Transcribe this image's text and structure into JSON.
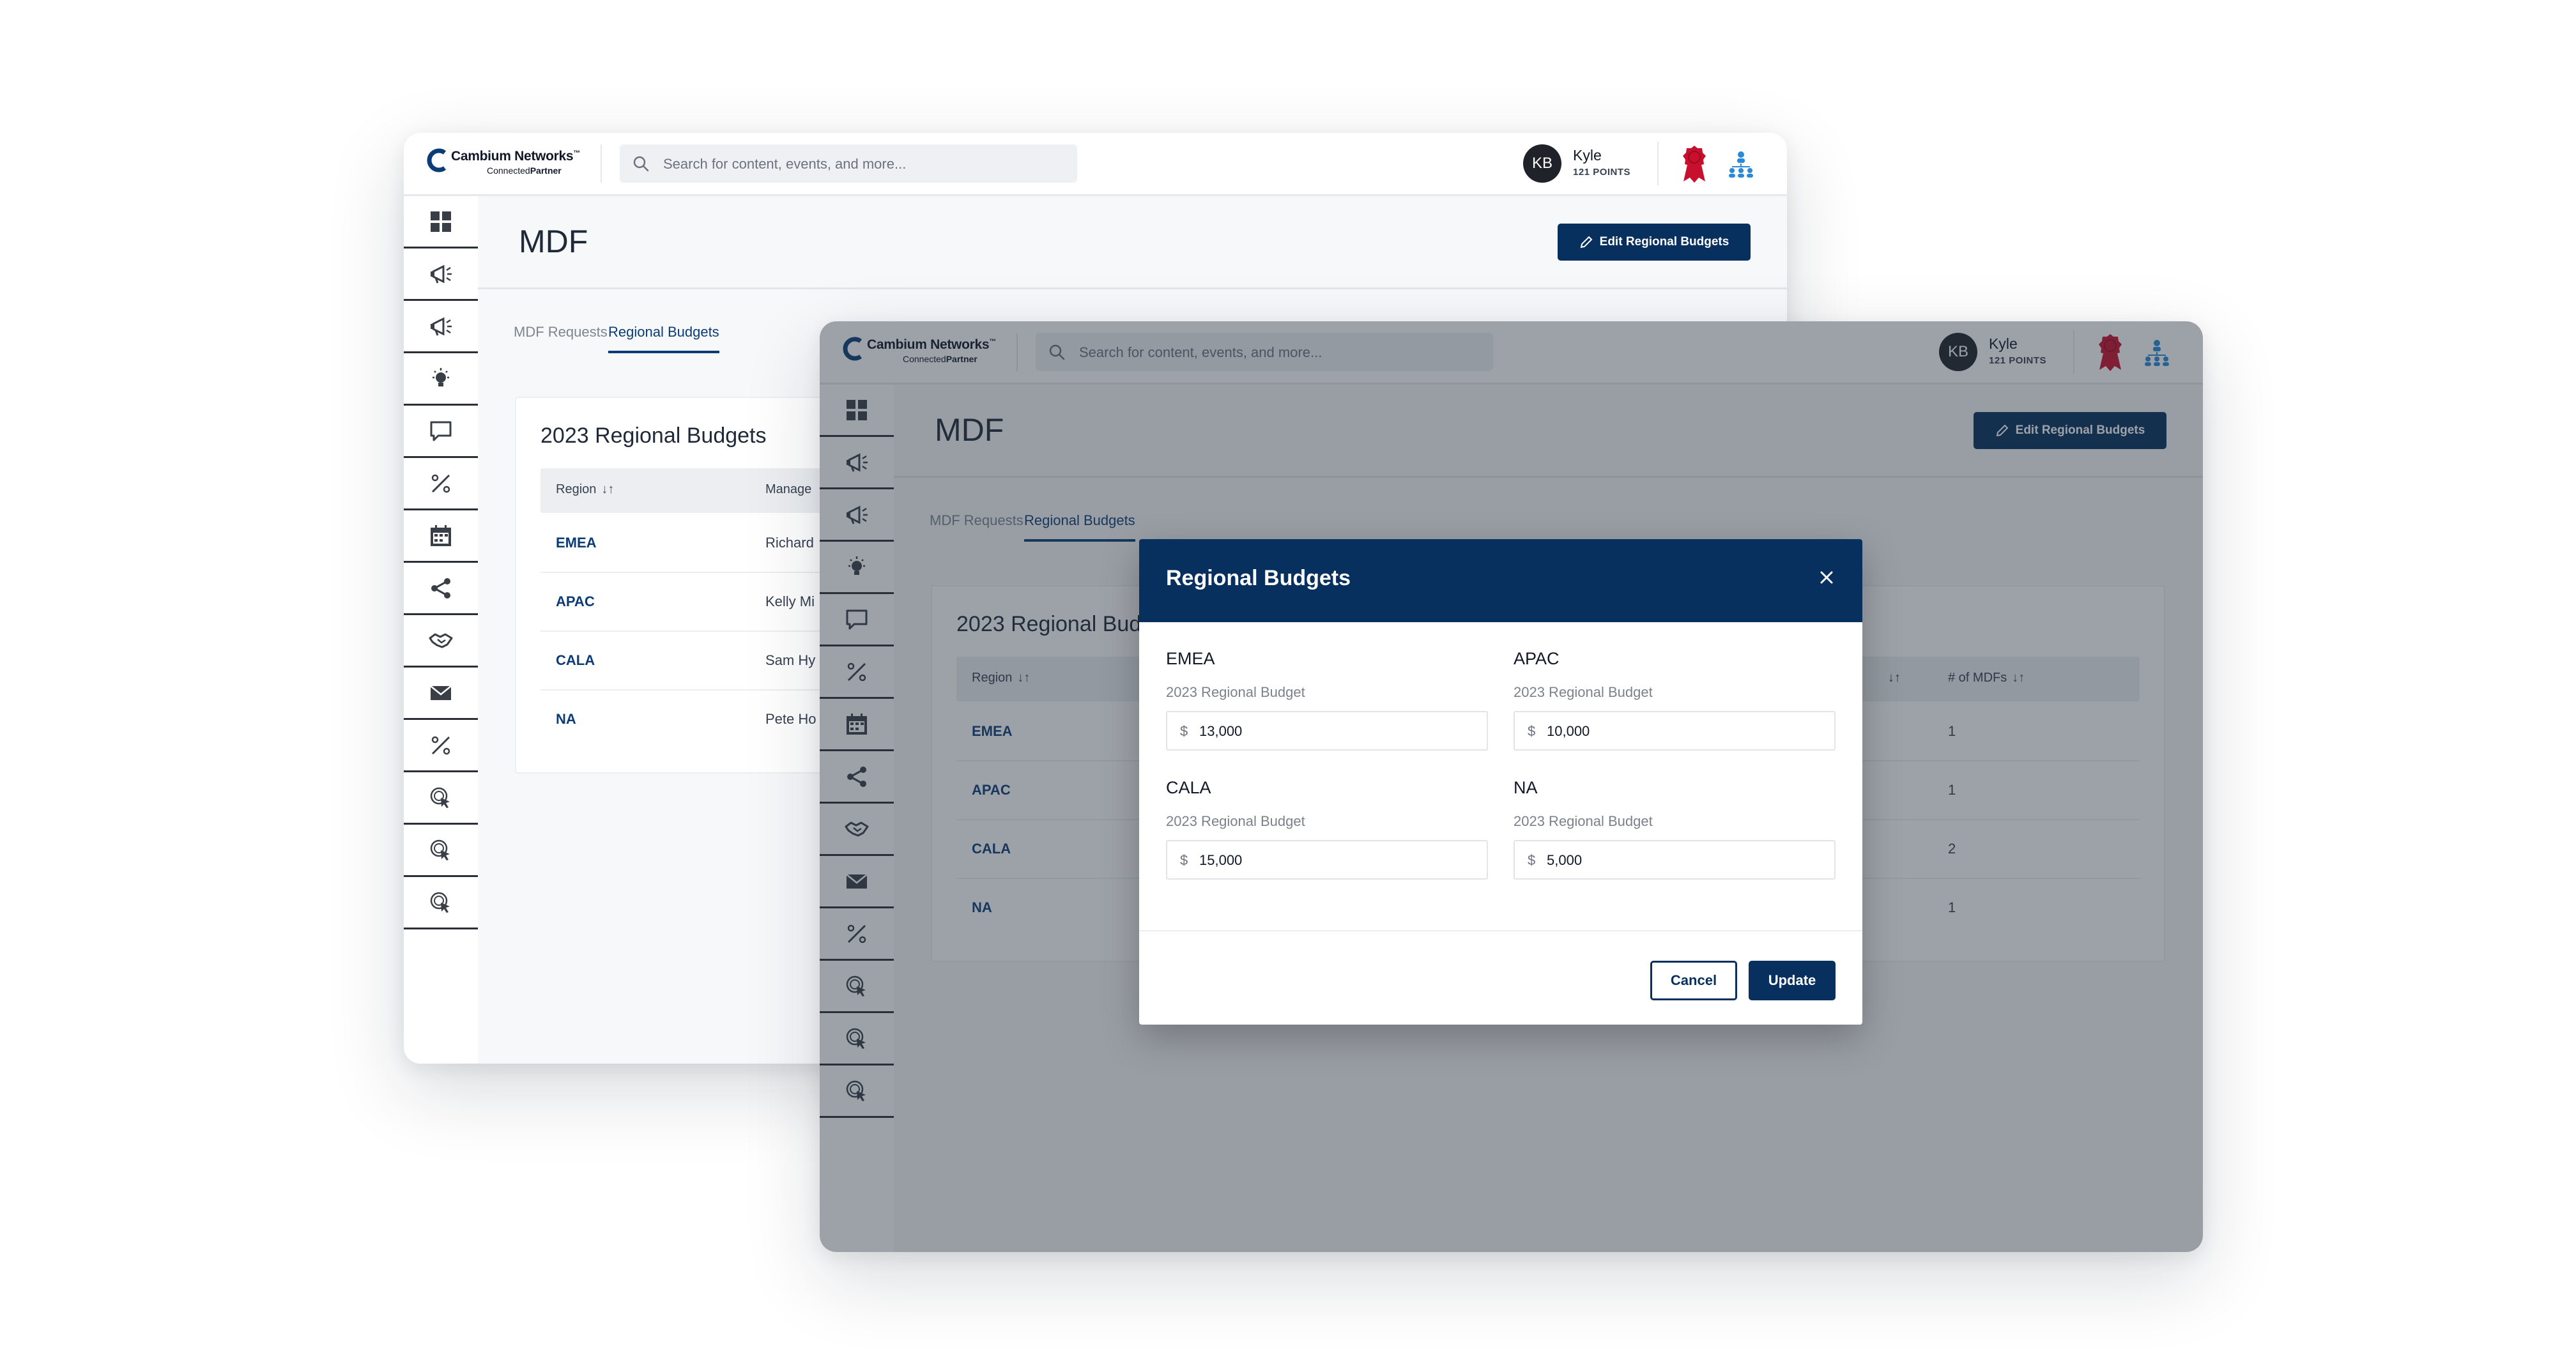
{
  "brand": {
    "name": "Cambium Networks",
    "trademark": "™",
    "sub_prefix": "Connected",
    "sub_bold": "Partner"
  },
  "search": {
    "placeholder": "Search for content, events, and more..."
  },
  "user": {
    "initials": "KB",
    "name": "Kyle",
    "points": "121 POINTS"
  },
  "header_icons": [
    "award-ribbon-icon",
    "org-chart-icon"
  ],
  "sidebar": {
    "items": [
      {
        "icon": "dashboard-grid-icon"
      },
      {
        "icon": "megaphone-icon"
      },
      {
        "icon": "megaphone-icon"
      },
      {
        "icon": "lightbulb-icon"
      },
      {
        "icon": "chat-bubble-icon"
      },
      {
        "icon": "discount-icon"
      },
      {
        "icon": "calendar-icon"
      },
      {
        "icon": "share-icon"
      },
      {
        "icon": "handshake-icon"
      },
      {
        "icon": "envelope-icon"
      },
      {
        "icon": "discount-icon"
      },
      {
        "icon": "money-click-icon"
      },
      {
        "icon": "money-click-icon"
      },
      {
        "icon": "money-click-icon"
      }
    ]
  },
  "page": {
    "title": "MDF",
    "edit_button": "Edit Regional Budgets",
    "tabs": [
      {
        "label": "MDF Requests",
        "active": false
      },
      {
        "label": "Regional Budgets",
        "active": true
      }
    ]
  },
  "table": {
    "title": "2023 Regional Budgets",
    "back_window_headers": [
      "Region",
      "Manage"
    ],
    "front_window_headers": [
      "Region",
      "# of MDFs"
    ],
    "sort_glyph": "↓↑",
    "rows": [
      {
        "region": "EMEA",
        "manager": "Richard",
        "mdfs": "1"
      },
      {
        "region": "APAC",
        "manager": "Kelly Mi",
        "mdfs": "1"
      },
      {
        "region": "CALA",
        "manager": "Sam Hy",
        "mdfs": "2"
      },
      {
        "region": "NA",
        "manager": "Pete Ho",
        "mdfs": "1"
      }
    ]
  },
  "modal": {
    "title": "Regional Budgets",
    "currency": "$",
    "fields": [
      {
        "region": "EMEA",
        "label": "2023 Regional Budget",
        "value": "13,000"
      },
      {
        "region": "APAC",
        "label": "2023 Regional Budget",
        "value": "10,000"
      },
      {
        "region": "CALA",
        "label": "2023 Regional Budget",
        "value": "15,000"
      },
      {
        "region": "NA",
        "label": "2023 Regional Budget",
        "value": "5,000"
      }
    ],
    "cancel": "Cancel",
    "update": "Update"
  },
  "colors": {
    "primary_navy": "#07305e",
    "link_blue": "#0b3c77",
    "award_red": "#c8102e",
    "org_blue": "#2a8ad8",
    "overlay": "#26303e"
  }
}
